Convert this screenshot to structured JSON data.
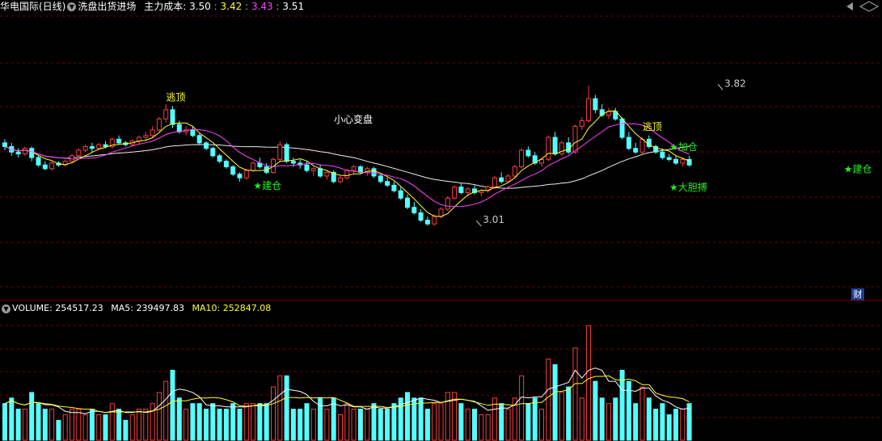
{
  "header": {
    "stock_name": "华电国际(日线)",
    "indicator_name": "洗盘出货进场",
    "cost_label": "主力成本:",
    "cost_values": [
      "3.50",
      "3.42",
      "3.43",
      "3.51"
    ],
    "cost_colors": [
      "#ffffff",
      "#ffff33",
      "#ff44ff",
      "#ffffff"
    ]
  },
  "volume_header": {
    "volume_label": "VOLUME:",
    "volume_value": "254517.23",
    "ma5_label": "MA5:",
    "ma5_value": "239497.83",
    "ma10_label": "MA10:",
    "ma10_value": "252847.08"
  },
  "fin_badge": "财",
  "colors": {
    "up": "#ff3c3c",
    "down": "#54ffff",
    "ma_fast": "#ffff33",
    "ma_mid": "#ff44ff",
    "ma_slow": "#eeeeee",
    "grid": "#7a0000",
    "signal_green": "#22ee22",
    "signal_yellow": "#ffff33"
  },
  "chart_data": {
    "type": "candlestick",
    "price_candles": [
      [
        3.24,
        3.26,
        3.2,
        3.22
      ],
      [
        3.22,
        3.24,
        3.17,
        3.19
      ],
      [
        3.19,
        3.21,
        3.16,
        3.18
      ],
      [
        3.18,
        3.22,
        3.17,
        3.21
      ],
      [
        3.21,
        3.22,
        3.14,
        3.16
      ],
      [
        3.16,
        3.17,
        3.11,
        3.12
      ],
      [
        3.12,
        3.14,
        3.09,
        3.1
      ],
      [
        3.1,
        3.14,
        3.09,
        3.13
      ],
      [
        3.13,
        3.14,
        3.11,
        3.12
      ],
      [
        3.12,
        3.15,
        3.11,
        3.14
      ],
      [
        3.14,
        3.18,
        3.13,
        3.17
      ],
      [
        3.17,
        3.21,
        3.16,
        3.2
      ],
      [
        3.2,
        3.23,
        3.19,
        3.22
      ],
      [
        3.22,
        3.24,
        3.19,
        3.21
      ],
      [
        3.21,
        3.24,
        3.2,
        3.23
      ],
      [
        3.23,
        3.25,
        3.21,
        3.22
      ],
      [
        3.22,
        3.27,
        3.21,
        3.26
      ],
      [
        3.26,
        3.28,
        3.23,
        3.24
      ],
      [
        3.24,
        3.25,
        3.22,
        3.23
      ],
      [
        3.23,
        3.26,
        3.22,
        3.25
      ],
      [
        3.25,
        3.28,
        3.23,
        3.27
      ],
      [
        3.27,
        3.3,
        3.25,
        3.28
      ],
      [
        3.28,
        3.33,
        3.27,
        3.31
      ],
      [
        3.31,
        3.38,
        3.3,
        3.37
      ],
      [
        3.37,
        3.45,
        3.35,
        3.42
      ],
      [
        3.42,
        3.44,
        3.32,
        3.34
      ],
      [
        3.34,
        3.36,
        3.29,
        3.3
      ],
      [
        3.3,
        3.33,
        3.28,
        3.31
      ],
      [
        3.31,
        3.33,
        3.27,
        3.28
      ],
      [
        3.28,
        3.29,
        3.23,
        3.24
      ],
      [
        3.24,
        3.25,
        3.2,
        3.21
      ],
      [
        3.21,
        3.22,
        3.16,
        3.17
      ],
      [
        3.17,
        3.18,
        3.13,
        3.14
      ],
      [
        3.14,
        3.15,
        3.1,
        3.11
      ],
      [
        3.11,
        3.12,
        3.06,
        3.07
      ],
      [
        3.07,
        3.08,
        3.03,
        3.05
      ],
      [
        3.05,
        3.1,
        3.04,
        3.09
      ],
      [
        3.09,
        3.14,
        3.08,
        3.13
      ],
      [
        3.13,
        3.16,
        3.1,
        3.11
      ],
      [
        3.11,
        3.13,
        3.07,
        3.08
      ],
      [
        3.08,
        3.16,
        3.07,
        3.15
      ],
      [
        3.15,
        3.25,
        3.14,
        3.23
      ],
      [
        3.23,
        3.24,
        3.13,
        3.14
      ],
      [
        3.14,
        3.16,
        3.11,
        3.13
      ],
      [
        3.13,
        3.15,
        3.1,
        3.12
      ],
      [
        3.12,
        3.14,
        3.08,
        3.09
      ],
      [
        3.09,
        3.11,
        3.06,
        3.1
      ],
      [
        3.1,
        3.12,
        3.05,
        3.06
      ],
      [
        3.06,
        3.09,
        3.04,
        3.08
      ],
      [
        3.08,
        3.09,
        3.02,
        3.03
      ],
      [
        3.03,
        3.06,
        3.02,
        3.05
      ],
      [
        3.05,
        3.1,
        3.04,
        3.09
      ],
      [
        3.09,
        3.12,
        3.07,
        3.11
      ],
      [
        3.11,
        3.12,
        3.07,
        3.08
      ],
      [
        3.08,
        3.11,
        3.06,
        3.1
      ],
      [
        3.1,
        3.11,
        3.05,
        3.06
      ],
      [
        3.06,
        3.07,
        3.02,
        3.03
      ],
      [
        3.03,
        3.05,
        3.0,
        3.01
      ],
      [
        3.01,
        3.03,
        2.97,
        2.98
      ],
      [
        2.98,
        3.0,
        2.93,
        2.94
      ],
      [
        2.94,
        2.96,
        2.88,
        2.89
      ],
      [
        2.89,
        2.92,
        2.85,
        2.86
      ],
      [
        2.86,
        2.88,
        2.81,
        2.82
      ],
      [
        2.82,
        2.84,
        2.79,
        2.8
      ],
      [
        2.8,
        2.85,
        2.79,
        2.84
      ],
      [
        2.84,
        2.89,
        2.83,
        2.88
      ],
      [
        2.88,
        2.95,
        2.87,
        2.94
      ],
      [
        2.94,
        3.01,
        2.93,
        3.0
      ],
      [
        3.0,
        3.02,
        2.96,
        2.97
      ],
      [
        2.97,
        3.0,
        2.95,
        2.99
      ],
      [
        2.99,
        3.01,
        2.96,
        2.97
      ],
      [
        2.97,
        2.99,
        2.95,
        2.98
      ],
      [
        2.98,
        3.01,
        2.97,
        3.0
      ],
      [
        3.0,
        3.06,
        2.99,
        3.05
      ],
      [
        3.05,
        3.08,
        3.02,
        3.03
      ],
      [
        3.03,
        3.07,
        3.02,
        3.06
      ],
      [
        3.06,
        3.12,
        3.05,
        3.11
      ],
      [
        3.11,
        3.21,
        3.1,
        3.2
      ],
      [
        3.2,
        3.22,
        3.16,
        3.17
      ],
      [
        3.17,
        3.19,
        3.12,
        3.13
      ],
      [
        3.13,
        3.16,
        3.11,
        3.15
      ],
      [
        3.15,
        3.28,
        3.14,
        3.27
      ],
      [
        3.27,
        3.3,
        3.17,
        3.18
      ],
      [
        3.18,
        3.25,
        3.17,
        3.24
      ],
      [
        3.24,
        3.27,
        3.18,
        3.19
      ],
      [
        3.19,
        3.34,
        3.18,
        3.33
      ],
      [
        3.33,
        3.38,
        3.31,
        3.36
      ],
      [
        3.36,
        3.55,
        3.35,
        3.48
      ],
      [
        3.48,
        3.5,
        3.4,
        3.42
      ],
      [
        3.42,
        3.45,
        3.38,
        3.39
      ],
      [
        3.39,
        3.43,
        3.37,
        3.41
      ],
      [
        3.41,
        3.43,
        3.36,
        3.37
      ],
      [
        3.37,
        3.38,
        3.26,
        3.27
      ],
      [
        3.27,
        3.3,
        3.2,
        3.21
      ],
      [
        3.21,
        3.24,
        3.18,
        3.19
      ],
      [
        3.19,
        3.27,
        3.18,
        3.26
      ],
      [
        3.26,
        3.28,
        3.21,
        3.22
      ],
      [
        3.22,
        3.23,
        3.18,
        3.19
      ],
      [
        3.19,
        3.21,
        3.15,
        3.16
      ],
      [
        3.16,
        3.18,
        3.14,
        3.15
      ],
      [
        3.15,
        3.17,
        3.12,
        3.13
      ],
      [
        3.13,
        3.16,
        3.11,
        3.15
      ],
      [
        3.15,
        3.17,
        3.11,
        3.12
      ]
    ],
    "ma5_volume_note": "",
    "annotations": [
      {
        "text": "逃顶",
        "bar": 25,
        "price": 3.47,
        "color": "#ffff33"
      },
      {
        "text": "小心变盘",
        "bar": 50,
        "price": 3.35,
        "color": "#ffffff"
      },
      {
        "text": "★建仓",
        "bar": 38,
        "price": 2.99,
        "color": "#22ee22"
      },
      {
        "text": "3.01",
        "bar": 71,
        "price": 2.805,
        "color": "#cccccc",
        "arrow": true
      },
      {
        "text": "逃顶",
        "bar": 96,
        "price": 3.31,
        "color": "#ffff33"
      },
      {
        "text": "3.82",
        "bar": 107,
        "price": 3.545,
        "color": "#cccccc",
        "arrow": true
      },
      {
        "text": "★加仓",
        "bar": 100,
        "price": 3.2,
        "color": "#22ee22"
      },
      {
        "text": "★大胆搏",
        "bar": 100,
        "price": 2.98,
        "color": "#22ee22"
      },
      {
        "text": "★建仓",
        "bar": 126,
        "price": 3.08,
        "color": "#22ee22"
      }
    ]
  }
}
